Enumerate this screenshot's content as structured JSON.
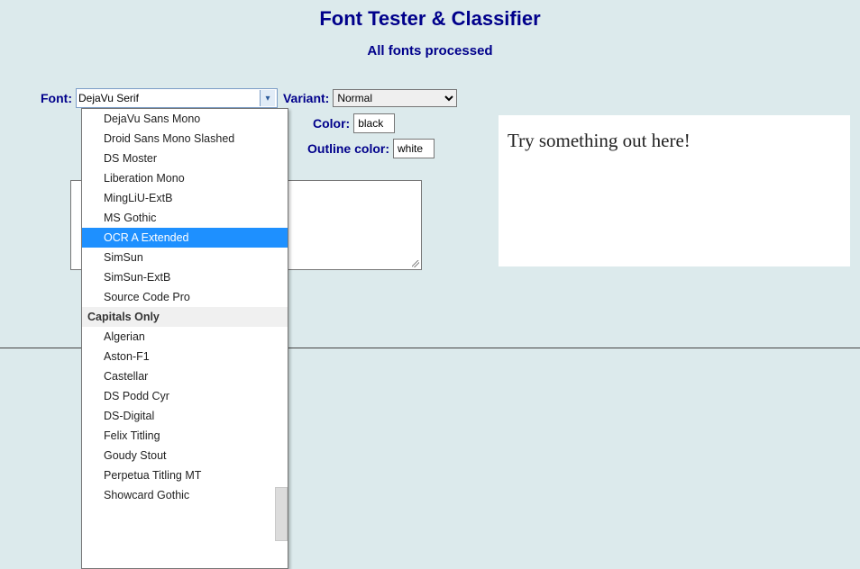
{
  "title": "Font Tester & Classifier",
  "subtitle": "All fonts processed",
  "labels": {
    "font": "Font:",
    "variant": "Variant:",
    "color": "Color:",
    "outline": "Outline color:"
  },
  "values": {
    "font_selected": "DejaVu Serif",
    "variant_selected": "Normal",
    "color": "black",
    "outline": "white"
  },
  "preview_text": "Try something out here!",
  "dropdown": {
    "highlight_index": 6,
    "items": [
      {
        "type": "opt",
        "label": "DejaVu Sans Mono"
      },
      {
        "type": "opt",
        "label": "Droid Sans Mono Slashed"
      },
      {
        "type": "opt",
        "label": "DS Moster"
      },
      {
        "type": "opt",
        "label": "Liberation Mono"
      },
      {
        "type": "opt",
        "label": "MingLiU-ExtB"
      },
      {
        "type": "opt",
        "label": "MS Gothic"
      },
      {
        "type": "opt",
        "label": "OCR A Extended"
      },
      {
        "type": "opt",
        "label": "SimSun"
      },
      {
        "type": "opt",
        "label": "SimSun-ExtB"
      },
      {
        "type": "opt",
        "label": "Source Code Pro"
      },
      {
        "type": "group",
        "label": "Capitals Only"
      },
      {
        "type": "opt",
        "label": "Algerian"
      },
      {
        "type": "opt",
        "label": "Aston-F1"
      },
      {
        "type": "opt",
        "label": "Castellar"
      },
      {
        "type": "opt",
        "label": "DS Podd Cyr"
      },
      {
        "type": "opt",
        "label": "DS-Digital"
      },
      {
        "type": "opt",
        "label": "Felix Titling"
      },
      {
        "type": "opt",
        "label": "Goudy Stout"
      },
      {
        "type": "opt",
        "label": "Perpetua Titling MT"
      },
      {
        "type": "opt",
        "label": "Showcard Gothic"
      }
    ]
  }
}
